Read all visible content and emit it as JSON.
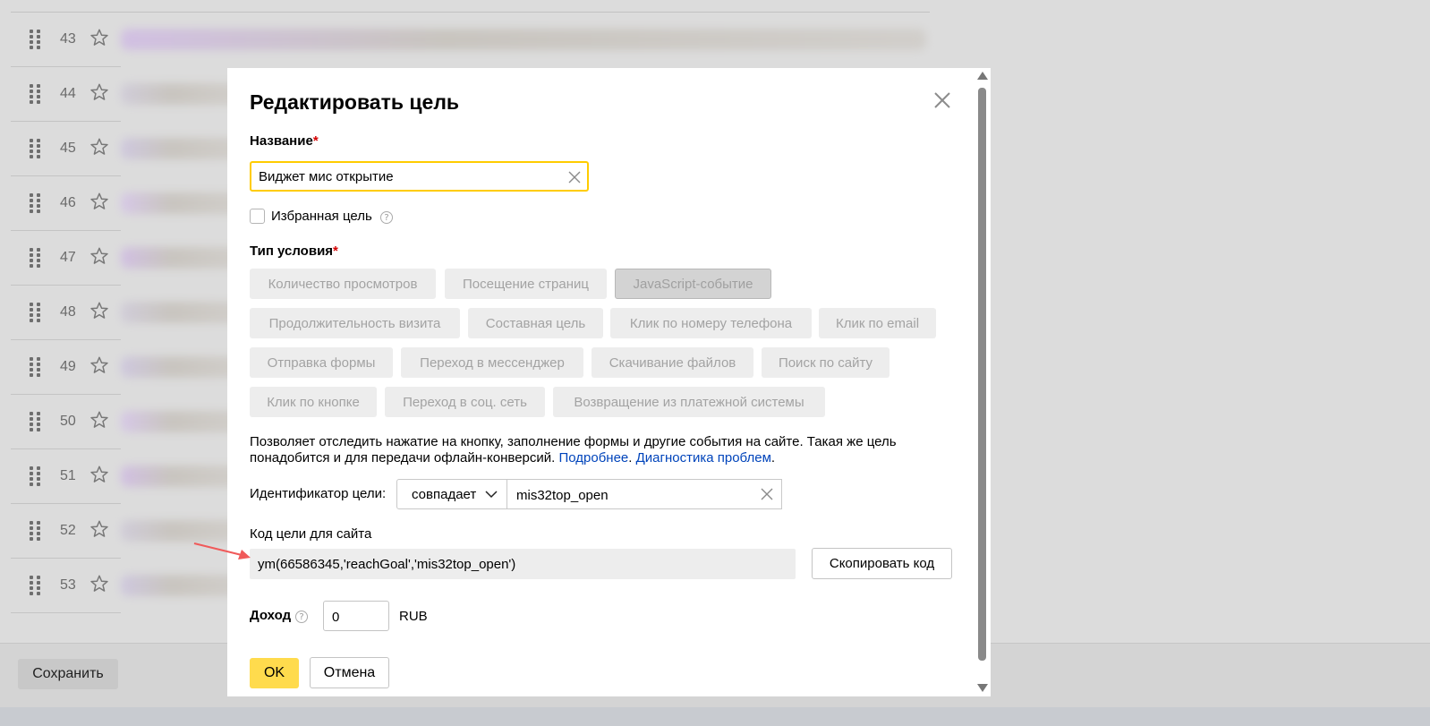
{
  "background": {
    "rows": [
      {
        "num": "43"
      },
      {
        "num": "44"
      },
      {
        "num": "45"
      },
      {
        "num": "46"
      },
      {
        "num": "47"
      },
      {
        "num": "48"
      },
      {
        "num": "49"
      },
      {
        "num": "50"
      },
      {
        "num": "51"
      },
      {
        "num": "52"
      },
      {
        "num": "53"
      }
    ],
    "save_label": "Сохранить"
  },
  "modal": {
    "title": "Редактировать цель",
    "name_label": "Название",
    "required_mark": "*",
    "name_value": "Виджет мис открытие",
    "favorite_label": "Избранная цель",
    "help_glyph": "?",
    "condition_label": "Тип условия",
    "condition_types": [
      {
        "label": "Количество просмотров",
        "selected": false
      },
      {
        "label": "Посещение страниц",
        "selected": false
      },
      {
        "label": "JavaScript-событие",
        "selected": true
      },
      {
        "label": "Продолжительность визита",
        "selected": false
      },
      {
        "label": "Составная цель",
        "selected": false
      },
      {
        "label": "Клик по номеру телефона",
        "selected": false
      },
      {
        "label": "Клик по email",
        "selected": false
      },
      {
        "label": "Отправка формы",
        "selected": false
      },
      {
        "label": "Переход в мессенджер",
        "selected": false
      },
      {
        "label": "Скачивание файлов",
        "selected": false
      },
      {
        "label": "Поиск по сайту",
        "selected": false
      },
      {
        "label": "Клик по кнопке",
        "selected": false
      },
      {
        "label": "Переход в соц. сеть",
        "selected": false
      },
      {
        "label": "Возвращение из платежной системы",
        "selected": false
      }
    ],
    "description": {
      "text": "Позволяет отследить нажатие на кнопку, заполнение формы и другие события на сайте. Такая же цель понадобится и для передачи офлайн-конверсий.",
      "link_more": "Подробнее",
      "link_diag": "Диагностика проблем",
      "end": "."
    },
    "identifier_label": "Идентификатор цели:",
    "match_select": "совпадает",
    "identifier_value": "mis32top_open",
    "code_label": "Код цели для сайта",
    "code_value": "ym(66586345,'reachGoal','mis32top_open')",
    "copy_label": "Скопировать код",
    "revenue_label": "Доход",
    "revenue_value": "0",
    "currency": "RUB",
    "ok_label": "OK",
    "cancel_label": "Отмена"
  },
  "colors": {
    "accent_yellow": "#ffdb4d",
    "focus_border": "#ffcc00",
    "link_blue": "#0044bb",
    "required_red": "#d40000",
    "annotation_arrow": "#f05a5a"
  },
  "icons": [
    "drag-handle-icon",
    "star-icon",
    "close-icon",
    "clear-icon",
    "help-icon",
    "chevron-down-icon",
    "scroll-arrow-icon"
  ]
}
